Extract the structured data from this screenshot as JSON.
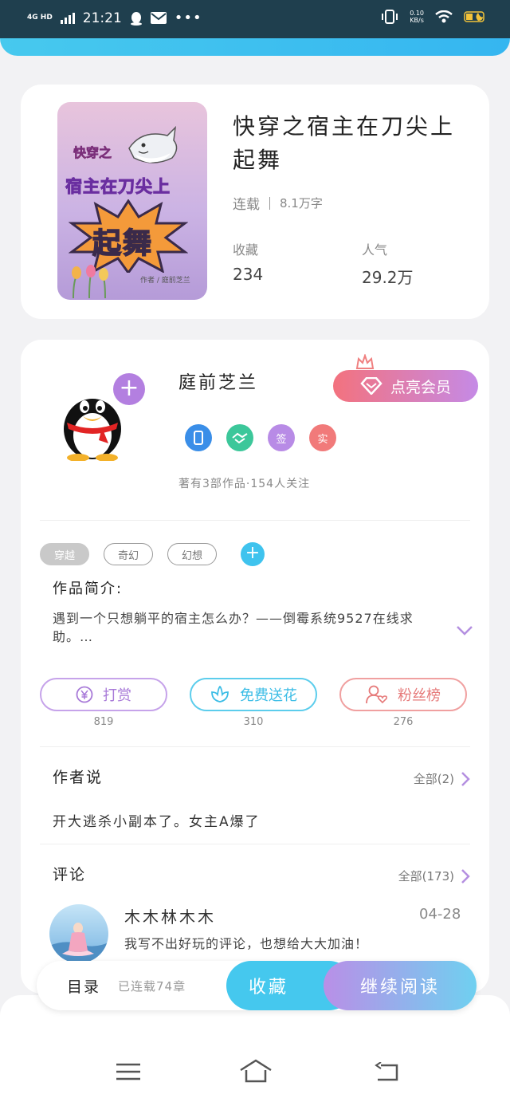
{
  "status_bar": {
    "network": "4G HD",
    "time": "21:21",
    "speed_value": "0.10",
    "speed_unit": "KB/s",
    "icons": [
      "signal-icon",
      "qq-icon",
      "mail-icon",
      "more-dots-icon",
      "vibrate-icon",
      "wifi-icon",
      "battery-icon"
    ]
  },
  "book": {
    "title": "快穿之宿主在刀尖上起舞",
    "status": "连载",
    "word_count": "8.1万字",
    "favorites_label": "收藏",
    "favorites_value": "234",
    "popularity_label": "人气",
    "popularity_value": "29.2万",
    "cover": {
      "tag": "快穿之",
      "line1": "宿主在刀尖上",
      "line2": "起舞",
      "author_line": "作者 / 庭前芝兰"
    }
  },
  "author": {
    "name": "庭前芝兰",
    "vip_button": "点亮会员",
    "badges": [
      {
        "name": "phone-badge-icon",
        "text": "",
        "color": "#3a8ee8"
      },
      {
        "name": "handshake-badge-icon",
        "text": "",
        "color": "#3cc79a"
      },
      {
        "name": "sign-badge",
        "text": "签",
        "color": "#b88be6"
      },
      {
        "name": "real-badge",
        "text": "实",
        "color": "#f17a7a"
      }
    ],
    "summary": "著有3部作品·154人关注"
  },
  "tags": [
    "穿越",
    "奇幻",
    "幻想"
  ],
  "intro": {
    "label": "作品简介:",
    "text": "遇到一个只想躺平的宿主怎么办？——倒霉系统9527在线求助。…"
  },
  "actions": {
    "reward_label": "打赏",
    "reward_count": "819",
    "flower_label": "免费送花",
    "flower_count": "310",
    "fans_label": "粉丝榜",
    "fans_count": "276"
  },
  "author_says": {
    "title": "作者说",
    "more": "全部(2)",
    "text": "开大逃杀小副本了。女主A爆了"
  },
  "comments": {
    "title": "评论",
    "more": "全部(173)",
    "items": [
      {
        "user": "木木林木木",
        "date": "04-28",
        "text": "我写不出好玩的评论，也想给大大加油！"
      }
    ]
  },
  "bottom_bar": {
    "toc_label": "目录",
    "toc_info": "已连载74章",
    "favorite_button": "收藏",
    "read_button": "继续阅读"
  },
  "colors": {
    "accent_blue": "#45c8ee",
    "accent_purple": "#b98fe7",
    "accent_red": "#f3727e"
  }
}
